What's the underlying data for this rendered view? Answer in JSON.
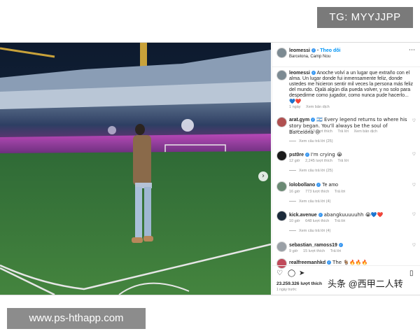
{
  "watermarks": {
    "top": "TG: MYYJJPP",
    "bottom": "www.ps-hthapp.com",
    "credit": "头条 @西甲二人转"
  },
  "post": {
    "author": "leomessi",
    "follow": "Theo dõi",
    "location": "Barcelona, Camp Nou",
    "caption": "Anoche volví a un lugar que extraño con el alma. Un lugar donde fui inmensamente feliz, donde ustedes me hicieron sentir mil veces la persona más feliz del mundo. Ojalá algún día pueda volver, y no solo para despedirme como jugador, como nunca pude hacerlo...",
    "caption_emoji": "💙❤️",
    "caption_time": "1 ngày",
    "see_translation": "Xem bản dịch",
    "likes": "23.259.326 lượt thích",
    "posted_ago": "1 ngày trước"
  },
  "comments": [
    {
      "user": "arat.gym",
      "verified": true,
      "text": "🇦🇷 Every legend returns to where his story began. You'll always be the soul of Barcelona 😢",
      "time": "17 giờ",
      "likes": "8,353 lượt thích",
      "reply": "Trả lời",
      "translate": "Xem bản dịch",
      "replies": "Xem câu trả lời (25)"
    },
    {
      "user": "pst0re",
      "verified": true,
      "text": "I'm crying 😭",
      "time": "12 giờ",
      "likes": "2,245 lượt thích",
      "reply": "Trả lời",
      "translate": "",
      "replies": "Xem câu trả lời (25)"
    },
    {
      "user": "lolobollano",
      "verified": true,
      "text": "Te amo",
      "time": "16 giờ",
      "likes": "773 lượt thích",
      "reply": "Trả lời",
      "translate": "",
      "replies": "Xem câu trả lời (4)"
    },
    {
      "user": "kick.avenue",
      "verified": true,
      "text": "abangkuuuuuhh 😭💙❤️",
      "time": "10 giờ",
      "likes": "648 lượt thích",
      "reply": "Trả lời",
      "translate": "",
      "replies": "Xem câu trả lời (4)"
    },
    {
      "user": "sebastian_ramoss19",
      "verified": true,
      "text": "",
      "time": "9 giờ",
      "likes": "15 lượt thích",
      "reply": "Trả lời",
      "translate": "",
      "replies": ""
    },
    {
      "user": "realfreemanhkd",
      "verified": true,
      "text": "The 🐐🔥🔥🔥",
      "time": "",
      "likes": "",
      "reply": "",
      "translate": "",
      "replies": ""
    }
  ],
  "icons": {
    "like": "heart-icon",
    "comment": "comment-icon",
    "share": "share-icon",
    "save": "bookmark-icon",
    "more": "more-icon",
    "carousel": "chevron-right-icon"
  },
  "colors": {
    "verified": "#3897f0",
    "pitch": "#3f7d3a",
    "stands_glow": "#c04ab8"
  }
}
